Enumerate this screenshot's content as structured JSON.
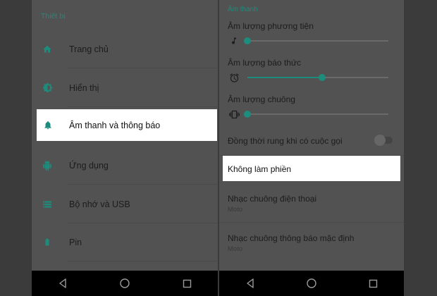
{
  "left": {
    "section_header": "Thiết bị",
    "items": [
      {
        "label": "Trang chủ",
        "icon": "home-icon"
      },
      {
        "label": "Hiển thị",
        "icon": "brightness-icon"
      },
      {
        "label": "Âm thanh và thông báo",
        "icon": "bell-icon",
        "selected": true
      },
      {
        "label": "Ứng dụng",
        "icon": "android-icon"
      },
      {
        "label": "Bộ nhớ và USB",
        "icon": "storage-icon"
      },
      {
        "label": "Pin",
        "icon": "battery-icon"
      }
    ]
  },
  "right": {
    "section_header": "Âm thanh",
    "volumes": [
      {
        "label": "Âm lượng phương tiện",
        "icon": "music-note-icon",
        "level": 0.0
      },
      {
        "label": "Âm lượng báo thức",
        "icon": "alarm-clock-icon",
        "level": 0.53
      },
      {
        "label": "Âm lượng chuông",
        "icon": "vibrate-icon",
        "level": 0.0
      }
    ],
    "vibrate_on_call": {
      "label": "Đồng thời rung khi có cuộc gọi",
      "enabled": false
    },
    "do_not_disturb": {
      "label": "Không làm phiền"
    },
    "ringtone": {
      "label": "Nhạc chuông điện thoại",
      "value": "Moto"
    },
    "notification_sound": {
      "label": "Nhạc chuông thông báo mặc định",
      "value": "Moto"
    }
  },
  "colors": {
    "accent": "#1e8c7c",
    "highlight": "#ffffff",
    "dim_background": "#525252",
    "nav_bar": "#000000"
  },
  "navbar_icons": [
    "back-icon",
    "home-circle-icon",
    "recents-icon"
  ]
}
